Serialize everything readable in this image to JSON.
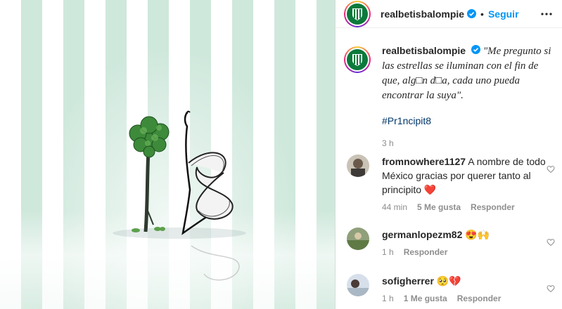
{
  "post": {
    "username": "realbetisbalompie",
    "follow_label": "Seguir",
    "separator": "•"
  },
  "caption": {
    "username": "realbetisbalompie",
    "text": "\"Me pregunto si las estrellas se iluminan con el fin de que, alg□n d□a, cada uno pueda encontrar la suya\".",
    "hashtag": "#Pr1ncipit8",
    "time": "3 h"
  },
  "comments": [
    {
      "username": "fromnowhere1127",
      "text": "A nombre de todo México gracias por querer tanto al principito ❤️",
      "time": "44 min",
      "likes": "5 Me gusta",
      "reply": "Responder"
    },
    {
      "username": "germanlopezm82",
      "text": "😍🙌",
      "time": "1 h",
      "reply": "Responder"
    },
    {
      "username": "sofigherrer",
      "text": "🥺💔",
      "time": "1 h",
      "likes": "1 Me gusta",
      "reply": "Responder"
    }
  ],
  "colors": {
    "stripe_green": "#cfe8dc",
    "betis_green": "#0b7a3b",
    "link_blue": "#0095f6",
    "hashtag_blue": "#00376b",
    "muted": "#8e8e8e"
  },
  "icons": [
    "verified-badge-icon",
    "more-options-icon",
    "heart-icon",
    "betis-crest-icon"
  ]
}
